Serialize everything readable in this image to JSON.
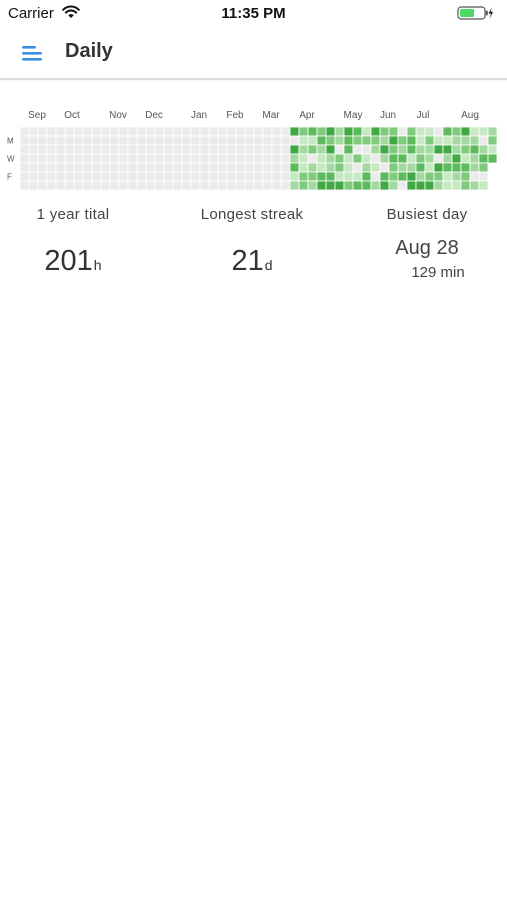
{
  "status_bar": {
    "carrier": "Carrier",
    "time": "11:35 PM",
    "wifi_icon": "wifi-icon",
    "battery_icon": "battery-charging-icon"
  },
  "nav": {
    "menu_icon": "hamburger-menu-icon",
    "title": "Daily"
  },
  "heatmap": {
    "months": [
      "Sep",
      "Oct",
      "Nov",
      "Dec",
      "Jan",
      "Feb",
      "Mar",
      "Apr",
      "May",
      "Jun",
      "Jul",
      "Aug"
    ],
    "weekday_labels": [
      "M",
      "W",
      "F"
    ],
    "weeks": 53,
    "active_from_week": 30,
    "colors": {
      "empty": "#ebebeb",
      "levels": [
        "#c6e8c3",
        "#a3d9a0",
        "#7fca7c",
        "#5dbb5d",
        "#42a845"
      ]
    }
  },
  "stats": {
    "total": {
      "label": "1 year tital",
      "value": "201",
      "unit": "h"
    },
    "streak": {
      "label": "Longest streak",
      "value": "21",
      "unit": "d"
    },
    "busiest": {
      "label": "Busiest day",
      "date": "Aug 28",
      "minutes": "129 min"
    }
  }
}
